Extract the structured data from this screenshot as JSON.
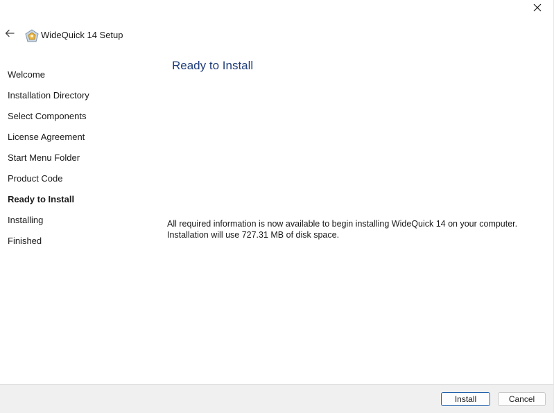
{
  "window": {
    "title": "WideQuick 14 Setup"
  },
  "icons": {
    "close": "close-icon",
    "back": "back-arrow-icon",
    "app": "app-logo-icon"
  },
  "sidebar": {
    "items": [
      {
        "label": "Welcome",
        "active": false
      },
      {
        "label": "Installation Directory",
        "active": false
      },
      {
        "label": "Select Components",
        "active": false
      },
      {
        "label": "License Agreement",
        "active": false
      },
      {
        "label": "Start Menu Folder",
        "active": false
      },
      {
        "label": "Product Code",
        "active": false
      },
      {
        "label": "Ready to Install",
        "active": true
      },
      {
        "label": "Installing",
        "active": false
      },
      {
        "label": "Finished",
        "active": false
      }
    ]
  },
  "main": {
    "heading": "Ready to Install",
    "info_line1": "All required information is now available to begin installing WideQuick 14 on your computer.",
    "info_line2": "Installation will use 727.31 MB of disk space."
  },
  "footer": {
    "install_label": "Install",
    "cancel_label": "Cancel"
  },
  "colors": {
    "heading": "#1f3d7a",
    "footer_bg": "#f0f0f0",
    "primary_border": "#1f5fa8"
  }
}
